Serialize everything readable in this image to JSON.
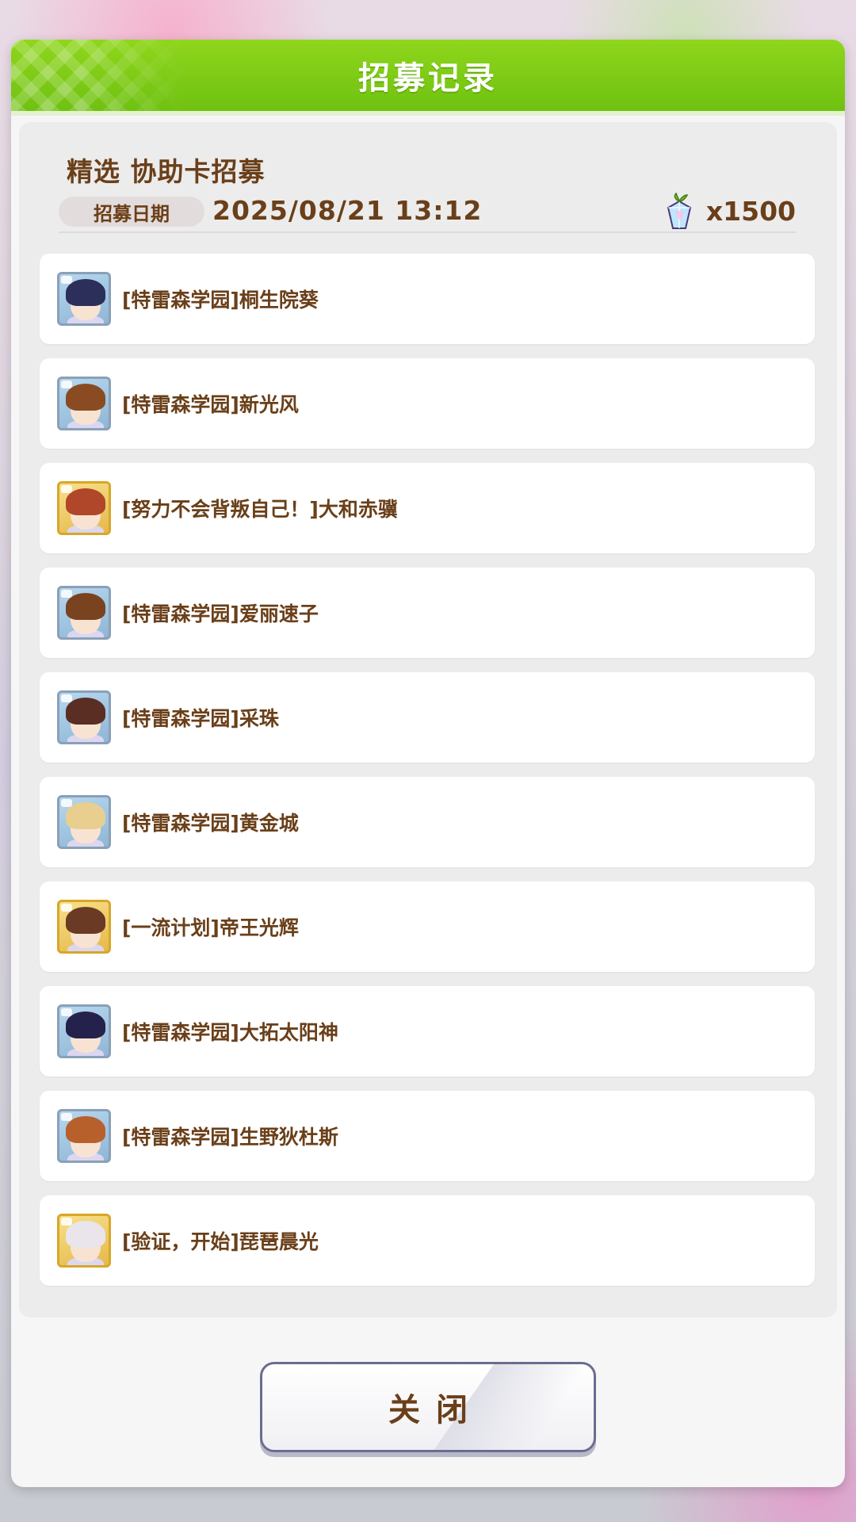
{
  "dialog": {
    "title": "招募记录"
  },
  "banner": {
    "title": "精选 协助卡招募",
    "date_label": "招募日期",
    "date_value": "2025/08/21  13:12",
    "cost_icon": "jewel-icon",
    "cost_value": "x1500"
  },
  "items": [
    {
      "label": "[特雷森学园]桐生院葵",
      "rarity": "silver",
      "hair": "#2b2f5a"
    },
    {
      "label": "[特雷森学园]新光风",
      "rarity": "silver",
      "hair": "#8a4b23"
    },
    {
      "label": "[努力不会背叛自己！]大和赤骥",
      "rarity": "gold",
      "hair": "#b0472a"
    },
    {
      "label": "[特雷森学园]爱丽速子",
      "rarity": "silver",
      "hair": "#7a4320"
    },
    {
      "label": "[特雷森学园]采珠",
      "rarity": "silver",
      "hair": "#5a2e22"
    },
    {
      "label": "[特雷森学园]黄金城",
      "rarity": "silver",
      "hair": "#e8cf8f"
    },
    {
      "label": "[一流计划]帝王光辉",
      "rarity": "gold",
      "hair": "#6b3a24"
    },
    {
      "label": "[特雷森学园]大拓太阳神",
      "rarity": "silver",
      "hair": "#24224d"
    },
    {
      "label": "[特雷森学园]生野狄杜斯",
      "rarity": "silver",
      "hair": "#b8602c"
    },
    {
      "label": "[验证，开始]琵琶晨光",
      "rarity": "gold",
      "hair": "#e9e5ea"
    }
  ],
  "close_button": {
    "label": "关闭"
  }
}
